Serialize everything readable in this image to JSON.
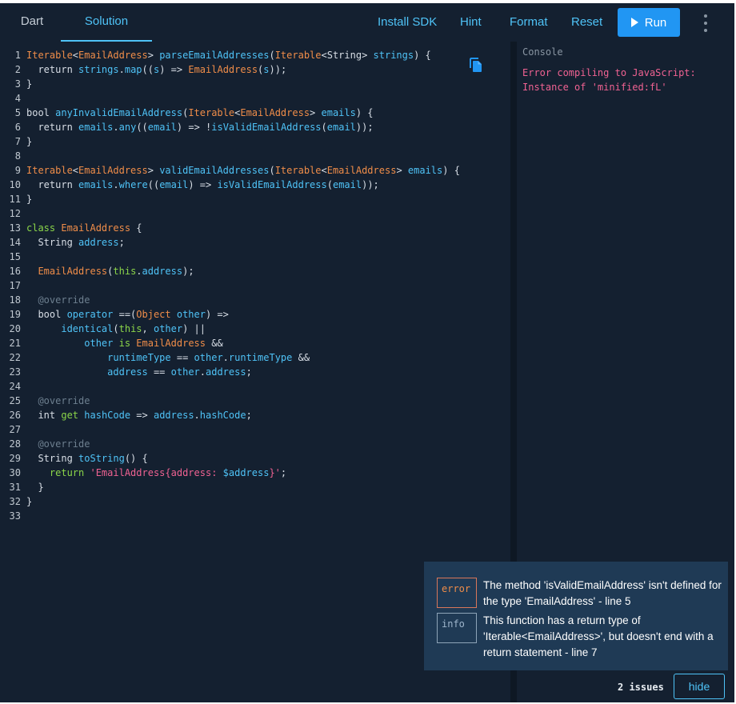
{
  "tabs": [
    {
      "label": "Dart"
    },
    {
      "label": "Solution",
      "active": true
    }
  ],
  "toolbar": {
    "install_sdk": "Install SDK",
    "hint": "Hint",
    "format": "Format",
    "reset": "Reset",
    "run": "Run",
    "more_icon": "more-vert-icon"
  },
  "editor": {
    "copy_icon": "copy-icon",
    "lines": [
      [
        [
          "Iterable",
          "t-type"
        ],
        [
          "<",
          "t-d"
        ],
        [
          "EmailAddress",
          "t-type"
        ],
        [
          "> ",
          "t-d"
        ],
        [
          "parseEmailAddresses",
          "t-fn"
        ],
        [
          "(",
          "t-d"
        ],
        [
          "Iterable",
          "t-type"
        ],
        [
          "<String> ",
          "t-d"
        ],
        [
          "strings",
          "t-fn"
        ],
        [
          ") {",
          "t-d"
        ]
      ],
      [
        [
          "  return ",
          "t-d"
        ],
        [
          "strings",
          "t-fn"
        ],
        [
          ".",
          "t-d"
        ],
        [
          "map",
          "t-fn"
        ],
        [
          "((",
          "t-d"
        ],
        [
          "s",
          "t-fn"
        ],
        [
          ") => ",
          "t-d"
        ],
        [
          "EmailAddress",
          "t-type"
        ],
        [
          "(",
          "t-d"
        ],
        [
          "s",
          "t-fn"
        ],
        [
          "));",
          "t-d"
        ]
      ],
      [
        [
          "}",
          "t-d"
        ]
      ],
      [
        [
          "",
          "t-d"
        ]
      ],
      [
        [
          "bool ",
          "t-d"
        ],
        [
          "anyInvalidEmailAddress",
          "t-fn"
        ],
        [
          "(",
          "t-d"
        ],
        [
          "Iterable",
          "t-type"
        ],
        [
          "<",
          "t-d"
        ],
        [
          "EmailAddress",
          "t-type"
        ],
        [
          "> ",
          "t-d"
        ],
        [
          "emails",
          "t-fn"
        ],
        [
          ") {",
          "t-d"
        ]
      ],
      [
        [
          "  return ",
          "t-d"
        ],
        [
          "emails",
          "t-fn"
        ],
        [
          ".",
          "t-d"
        ],
        [
          "any",
          "t-fn"
        ],
        [
          "((",
          "t-d"
        ],
        [
          "email",
          "t-fn"
        ],
        [
          ") => !",
          "t-d"
        ],
        [
          "isValidEmailAddress",
          "t-fn"
        ],
        [
          "(",
          "t-d"
        ],
        [
          "email",
          "t-fn"
        ],
        [
          "));",
          "t-d"
        ]
      ],
      [
        [
          "}",
          "t-d"
        ]
      ],
      [
        [
          "",
          "t-d"
        ]
      ],
      [
        [
          "Iterable",
          "t-type"
        ],
        [
          "<",
          "t-d"
        ],
        [
          "EmailAddress",
          "t-type"
        ],
        [
          "> ",
          "t-d"
        ],
        [
          "validEmailAddresses",
          "t-fn"
        ],
        [
          "(",
          "t-d"
        ],
        [
          "Iterable",
          "t-type"
        ],
        [
          "<",
          "t-d"
        ],
        [
          "EmailAddress",
          "t-type"
        ],
        [
          "> ",
          "t-d"
        ],
        [
          "emails",
          "t-fn"
        ],
        [
          ") {",
          "t-d"
        ]
      ],
      [
        [
          "  return ",
          "t-d"
        ],
        [
          "emails",
          "t-fn"
        ],
        [
          ".",
          "t-d"
        ],
        [
          "where",
          "t-fn"
        ],
        [
          "((",
          "t-d"
        ],
        [
          "email",
          "t-fn"
        ],
        [
          ") => ",
          "t-d"
        ],
        [
          "isValidEmailAddress",
          "t-fn"
        ],
        [
          "(",
          "t-d"
        ],
        [
          "email",
          "t-fn"
        ],
        [
          "));",
          "t-d"
        ]
      ],
      [
        [
          "}",
          "t-d"
        ]
      ],
      [
        [
          "",
          "t-d"
        ]
      ],
      [
        [
          "class ",
          "t-kw"
        ],
        [
          "EmailAddress",
          "t-type"
        ],
        [
          " {",
          "t-d"
        ]
      ],
      [
        [
          "  String ",
          "t-d"
        ],
        [
          "address",
          "t-fn"
        ],
        [
          ";",
          "t-d"
        ]
      ],
      [
        [
          "",
          "t-d"
        ]
      ],
      [
        [
          "  ",
          "t-d"
        ],
        [
          "EmailAddress",
          "t-type"
        ],
        [
          "(",
          "t-d"
        ],
        [
          "this",
          "t-kw"
        ],
        [
          ".",
          "t-d"
        ],
        [
          "address",
          "t-fn"
        ],
        [
          ");",
          "t-d"
        ]
      ],
      [
        [
          "",
          "t-d"
        ]
      ],
      [
        [
          "  @override",
          "t-ann"
        ]
      ],
      [
        [
          "  bool ",
          "t-d"
        ],
        [
          "operator",
          "t-fn"
        ],
        [
          " ==(",
          "t-d"
        ],
        [
          "Object ",
          "t-type"
        ],
        [
          "other",
          "t-fn"
        ],
        [
          ") =>",
          "t-d"
        ]
      ],
      [
        [
          "      ",
          "t-d"
        ],
        [
          "identical",
          "t-fn"
        ],
        [
          "(",
          "t-d"
        ],
        [
          "this",
          "t-kw"
        ],
        [
          ", ",
          "t-d"
        ],
        [
          "other",
          "t-fn"
        ],
        [
          ") ||",
          "t-d"
        ]
      ],
      [
        [
          "          ",
          "t-d"
        ],
        [
          "other ",
          "t-fn"
        ],
        [
          "is ",
          "t-kw"
        ],
        [
          "EmailAddress",
          "t-type"
        ],
        [
          " &&",
          "t-d"
        ]
      ],
      [
        [
          "              ",
          "t-d"
        ],
        [
          "runtimeType",
          "t-fn"
        ],
        [
          " == ",
          "t-d"
        ],
        [
          "other",
          "t-fn"
        ],
        [
          ".",
          "t-d"
        ],
        [
          "runtimeType",
          "t-fn"
        ],
        [
          " &&",
          "t-d"
        ]
      ],
      [
        [
          "              ",
          "t-d"
        ],
        [
          "address",
          "t-fn"
        ],
        [
          " == ",
          "t-d"
        ],
        [
          "other",
          "t-fn"
        ],
        [
          ".",
          "t-d"
        ],
        [
          "address",
          "t-fn"
        ],
        [
          ";",
          "t-d"
        ]
      ],
      [
        [
          "",
          "t-d"
        ]
      ],
      [
        [
          "  @override",
          "t-ann"
        ]
      ],
      [
        [
          "  int ",
          "t-d"
        ],
        [
          "get ",
          "t-kw"
        ],
        [
          "hashCode",
          "t-fn"
        ],
        [
          " => ",
          "t-d"
        ],
        [
          "address",
          "t-fn"
        ],
        [
          ".",
          "t-d"
        ],
        [
          "hashCode",
          "t-fn"
        ],
        [
          ";",
          "t-d"
        ]
      ],
      [
        [
          "",
          "t-d"
        ]
      ],
      [
        [
          "  @override",
          "t-ann"
        ]
      ],
      [
        [
          "  String ",
          "t-d"
        ],
        [
          "toString",
          "t-fn"
        ],
        [
          "() {",
          "t-d"
        ]
      ],
      [
        [
          "    return ",
          "t-kw"
        ],
        [
          "'EmailAddress{address: ",
          "t-str"
        ],
        [
          "$address",
          "t-fn"
        ],
        [
          "}'",
          "t-str"
        ],
        [
          ";",
          "t-d"
        ]
      ],
      [
        [
          "  }",
          "t-d"
        ]
      ],
      [
        [
          "}",
          "t-d"
        ]
      ],
      [
        [
          "",
          "t-d"
        ]
      ]
    ]
  },
  "console": {
    "label": "Console",
    "output": "Error compiling to JavaScript:\nInstance of 'minified:fL'"
  },
  "issues": {
    "items": [
      {
        "kind": "error",
        "message": "The method 'isValidEmailAddress' isn't defined for the type 'EmailAddress' - line 5"
      },
      {
        "kind": "info",
        "message": "This function has a return type of 'Iterable<EmailAddress>', but doesn't end with a return statement - line 7"
      }
    ],
    "count_label": "2 issues",
    "hide_label": "hide"
  },
  "colors": {
    "background": "#142030",
    "accent": "#4fc3f7",
    "run_button": "#2196f3",
    "issues_panel": "#1f3a55",
    "error_text": "#f06292"
  }
}
